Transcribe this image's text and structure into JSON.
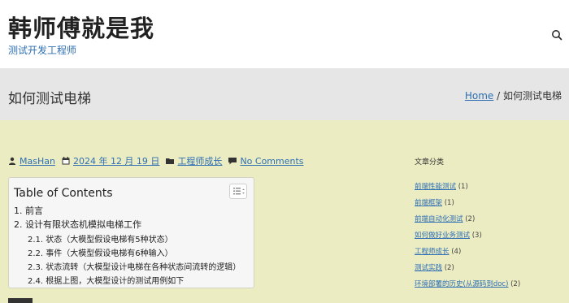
{
  "site": {
    "title": "韩师傅就是我",
    "description": "测试开发工程师"
  },
  "header": {
    "search_icon": "search-icon"
  },
  "page": {
    "title": "如何测试电梯"
  },
  "breadcrumb": {
    "home": "Home",
    "separator": "/",
    "current": "如何测试电梯"
  },
  "meta": {
    "author": "MasHan",
    "date": "2024 年 12 月 19 日",
    "category": "工程师成长",
    "comments": "No Comments"
  },
  "toc": {
    "title": "Table of Contents",
    "items": [
      {
        "label": "1. 前言"
      },
      {
        "label": "2. 设计有限状态机模拟电梯工作"
      },
      {
        "label": "2.1. 状态（大模型假设电梯有5种状态）"
      },
      {
        "label": "2.2. 事件（大模型假设电梯有6种输入）"
      },
      {
        "label": "2.3. 状态流转（大模型设计电梯在各种状态间流转的逻辑）"
      },
      {
        "label": "2.4. 根据上图，大模型设计的测试用例如下"
      }
    ]
  },
  "sidebar": {
    "widget_title": "文章分类",
    "categories": [
      {
        "name": "前端性能测试",
        "count": "(1)"
      },
      {
        "name": "前端框架",
        "count": "(1)"
      },
      {
        "name": "前端自动化测试",
        "count": "(2)"
      },
      {
        "name": "如何做好业务测试",
        "count": "(3)"
      },
      {
        "name": "工程师成长",
        "count": "(4)"
      },
      {
        "name": "测试实践",
        "count": "(2)"
      },
      {
        "name": "环境部署的历史(从源码到doc)",
        "count": "(2)"
      }
    ]
  },
  "colors": {
    "accent": "#2e6fb4",
    "page_bg": "#ebecc2",
    "title_bar": "#e6e6e6"
  }
}
